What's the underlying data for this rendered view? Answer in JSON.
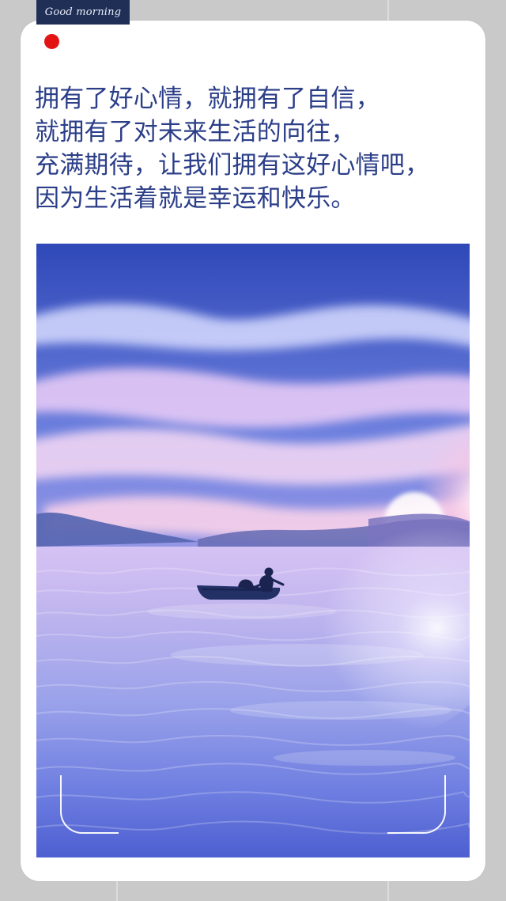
{
  "header": {
    "badge_text": "Good morning"
  },
  "poem": {
    "lines": [
      "拥有了好心情，就拥有了自信，",
      "就拥有了对未来生活的向往，",
      "充满期待，让我们拥有这好心情吧，",
      "因为生活着就是幸运和快乐。"
    ]
  },
  "colors": {
    "page_background": "#c9c9c9",
    "card_background": "#ffffff",
    "badge_background": "#1f2f56",
    "badge_text": "#e9edf8",
    "poem_text": "#2b3e88",
    "dot": "#e31414",
    "sky_top": "#2f48b8",
    "sky_mid": "#9f9ce9",
    "horizon_glow": "#ffd9ea",
    "water_top": "#d8c4f4",
    "water_bottom": "#4d5fd1"
  },
  "icons": {
    "top_indicator": "red-dot-icon",
    "photo_corners": "corner-frame-icon"
  }
}
